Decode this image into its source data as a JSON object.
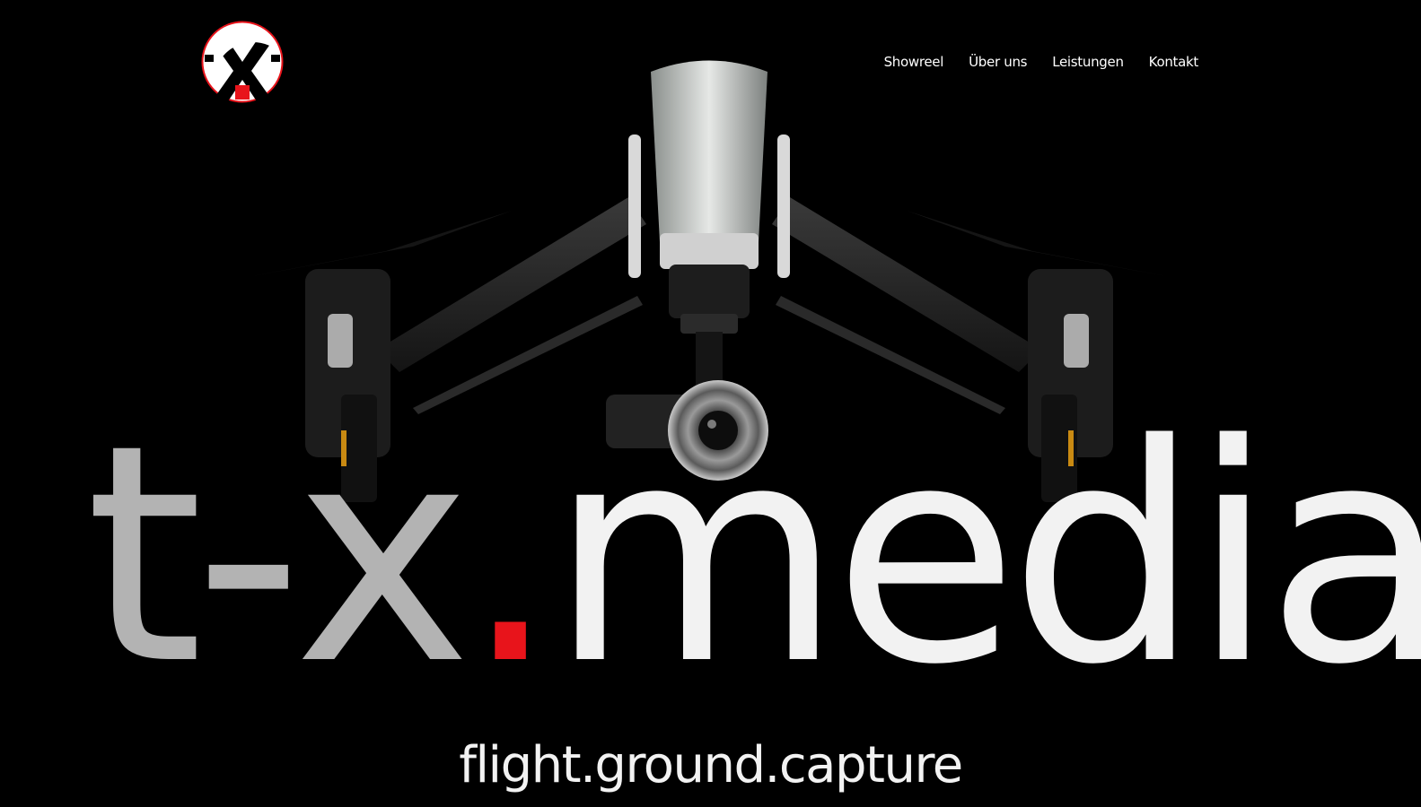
{
  "nav": {
    "items": [
      {
        "label": "Showreel"
      },
      {
        "label": "Über uns"
      },
      {
        "label": "Leistungen"
      },
      {
        "label": "Kontakt"
      }
    ]
  },
  "hero": {
    "wordmark_part1": "t-x",
    "wordmark_dot": ".",
    "wordmark_part2": "media",
    "tagline": "flight.ground.capture"
  },
  "colors": {
    "background": "#000000",
    "accent_red": "#e8141b",
    "wordmark_grey": "#b3b3b3",
    "wordmark_white": "#f2f2f2"
  },
  "icons": {
    "logo": "tx-media-logo"
  }
}
